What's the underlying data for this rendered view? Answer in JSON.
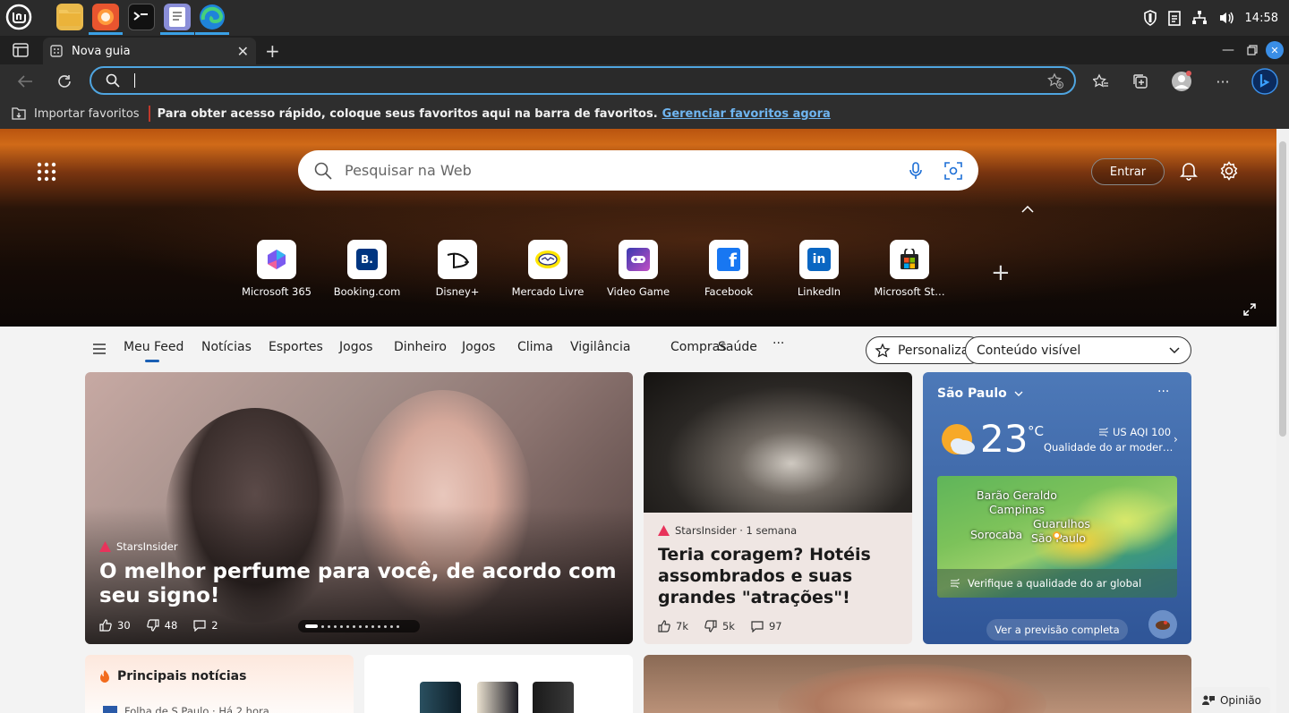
{
  "taskbar": {
    "time": "14:58"
  },
  "browser": {
    "tab_title": "Nova guia",
    "favorites_bar": {
      "import_label": "Importar favoritos",
      "message": "Para obter acesso rápido, coloque seus favoritos aqui na barra de favoritos.",
      "manage_link": "Gerenciar favoritos agora"
    }
  },
  "newtab": {
    "search_placeholder": "Pesquisar na Web",
    "signin_label": "Entrar",
    "quick_links": [
      {
        "label": "Microsoft 365",
        "icon": "microsoft365-icon"
      },
      {
        "label": "Booking.com",
        "icon": "booking-icon"
      },
      {
        "label": "Disney+",
        "icon": "disney-plus-icon"
      },
      {
        "label": "Mercado Livre",
        "icon": "mercado-livre-icon"
      },
      {
        "label": "Video Game",
        "icon": "video-game-icon"
      },
      {
        "label": "Facebook",
        "icon": "facebook-icon"
      },
      {
        "label": "LinkedIn",
        "icon": "linkedin-icon"
      },
      {
        "label": "Microsoft St…",
        "icon": "microsoft-store-icon"
      }
    ],
    "feed_nav": {
      "items": [
        "Meu Feed",
        "Notícias",
        "Esportes",
        "Jogos",
        "Dinheiro",
        "Jogos",
        "Clima",
        "Vigilância",
        "Compras",
        "Saúde"
      ],
      "more": "···",
      "personalize": "Personalizar",
      "content_select": "Conteúdo visível"
    },
    "cards": {
      "main": {
        "source": "StarsInsider",
        "title": "O melhor perfume para você, de acordo com seu signo!",
        "likes": "30",
        "dislikes": "48",
        "comments": "2"
      },
      "second": {
        "source": "StarsInsider · 1 semana",
        "title": "Teria coragem? Hotéis assombrados e suas grandes \"atrações\"!",
        "likes": "7k",
        "dislikes": "5k",
        "comments": "97"
      },
      "weather": {
        "city": "São Paulo",
        "temp": "23",
        "unit": "°C",
        "aqi": "US AQI 100",
        "aqi_desc": "Qualidade do ar moder…",
        "map_labels": [
          "Barão Geraldo",
          "Campinas",
          "Guarulhos",
          "Sorocaba",
          "São Paulo"
        ],
        "map_link": "Verifique a qualidade do ar global",
        "forecast_button": "Ver a previsão completa"
      },
      "top_news": {
        "title": "Principais notícias",
        "first_item": "Folha de S.Paulo · Há 2 hora"
      }
    },
    "feedback_label": "Opinião"
  }
}
